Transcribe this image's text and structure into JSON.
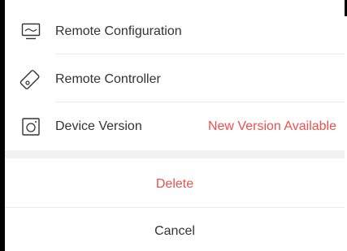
{
  "menu": {
    "items": [
      {
        "label": "Remote Configuration",
        "icon": "monitor-icon"
      },
      {
        "label": "Remote Controller",
        "icon": "remote-controller-icon"
      },
      {
        "label": "Device Version",
        "icon": "camera-icon",
        "status": "New Version Available"
      }
    ]
  },
  "actions": {
    "delete_label": "Delete",
    "cancel_label": "Cancel"
  },
  "colors": {
    "danger": "#ef4f4f",
    "text": "#333333",
    "divider": "#ececec",
    "section_gap": "#f2f2f2"
  }
}
